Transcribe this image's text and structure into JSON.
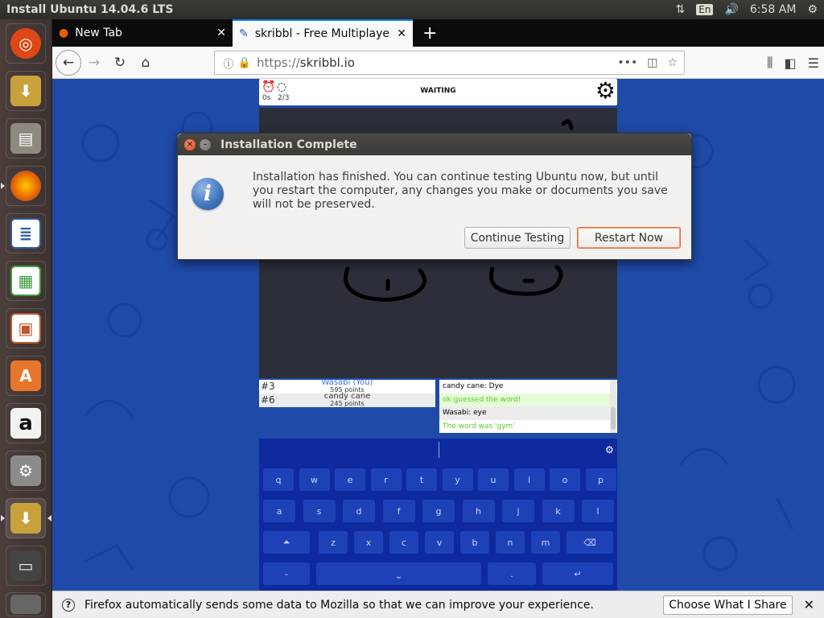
{
  "topbar": {
    "title": "Install Ubuntu 14.04.6 LTS",
    "keyboard_layout": "En",
    "time": "6:58 AM"
  },
  "launcher": {
    "items": [
      {
        "name": "ubuntu-dash",
        "color": "#e05a23"
      },
      {
        "name": "installer",
        "color": "#c9a13c"
      },
      {
        "name": "files",
        "color": "#8e8a80"
      },
      {
        "name": "firefox",
        "color": "#e66000"
      },
      {
        "name": "libreoffice-writer",
        "color": "#2b5fa8"
      },
      {
        "name": "libreoffice-calc",
        "color": "#3d9a3d"
      },
      {
        "name": "libreoffice-impress",
        "color": "#c0552b"
      },
      {
        "name": "software-center",
        "color": "#e7762d"
      },
      {
        "name": "amazon",
        "color": "#f2f2f2"
      },
      {
        "name": "system-settings",
        "color": "#8b8b8b"
      },
      {
        "name": "installer-running",
        "color": "#c9a13c"
      },
      {
        "name": "save-disk",
        "color": "#555"
      }
    ]
  },
  "browser": {
    "tabs": [
      {
        "label": "New Tab",
        "active": false
      },
      {
        "label": "skribbl - Free Multiplayer",
        "active": true
      }
    ],
    "url": {
      "protocol": "https://",
      "host": "skribbl.io"
    }
  },
  "game": {
    "timer": "0s",
    "round": "2/3",
    "state": "WAITING",
    "players": [
      {
        "rank": "#3",
        "name": "Wasabi (You)",
        "points": "595 points"
      },
      {
        "rank": "#6",
        "name": "candy cane",
        "points": "245 points"
      }
    ],
    "chat": [
      {
        "text": "candy cane: Dye",
        "style": "plain"
      },
      {
        "text": "ok guessed the word!",
        "style": "green"
      },
      {
        "text": "Wasabi: eye",
        "style": "alt"
      },
      {
        "text": "The word was 'gym'",
        "style": "greentxt"
      }
    ],
    "keyboard": {
      "row1": [
        "q",
        "w",
        "e",
        "r",
        "t",
        "y",
        "u",
        "i",
        "o",
        "p"
      ],
      "row2": [
        "a",
        "s",
        "d",
        "f",
        "g",
        "h",
        "j",
        "k",
        "l"
      ],
      "row3": [
        "⏶",
        "z",
        "x",
        "c",
        "v",
        "b",
        "n",
        "m",
        "⌫"
      ],
      "row4": [
        "-",
        "⎵",
        ".",
        "↵"
      ]
    }
  },
  "notification": {
    "message": "Firefox automatically sends some data to Mozilla so that we can improve your experience.",
    "button": "Choose What I Share"
  },
  "dialog": {
    "title": "Installation Complete",
    "message": "Installation has finished.  You can continue testing Ubuntu now, but until you restart the computer, any changes you make or documents you save will not be preserved.",
    "continue_label": "Continue Testing",
    "restart_label": "Restart Now"
  }
}
